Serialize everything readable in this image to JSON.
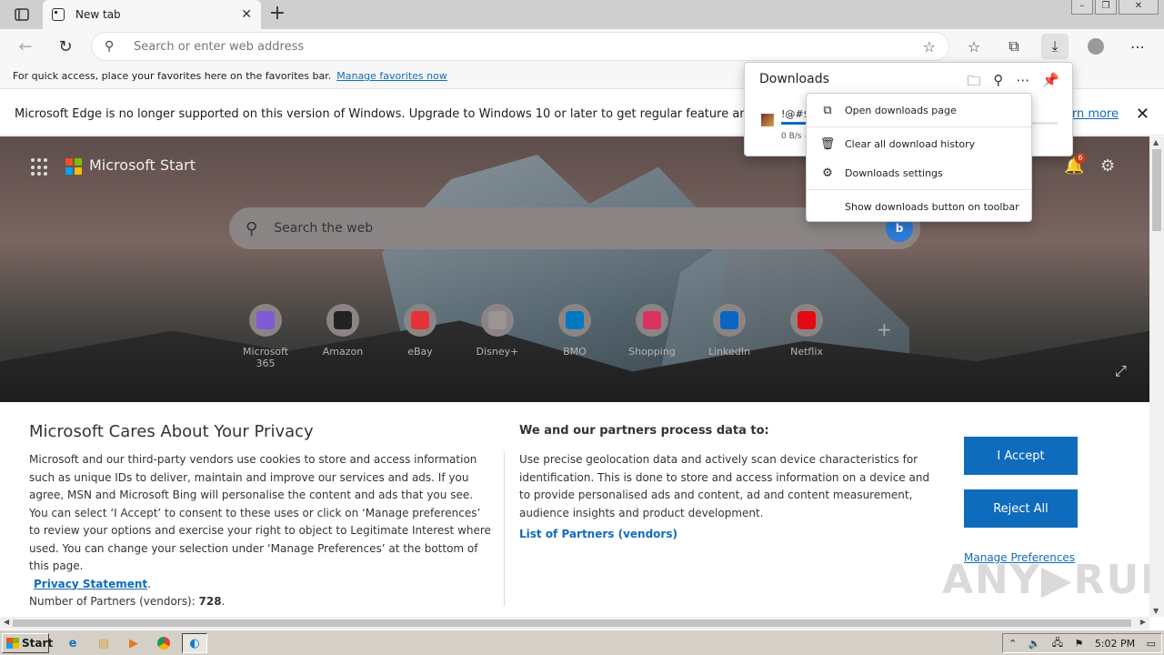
{
  "browser": {
    "tab_title": "New tab",
    "address_placeholder": "Search or enter web address",
    "favbar_text": "For quick access, place your favorites here on the favorites bar.",
    "favbar_link": "Manage favorites now",
    "infobar_text": "Microsoft Edge is no longer supported on this version of Windows. Upgrade to Windows 10 or later to get regular feature and security u",
    "infobar_link": "arn more"
  },
  "downloads": {
    "title": "Downloads",
    "item_name": "!@#$",
    "item_status": "0 B/s -",
    "progress": 0.1,
    "menu": [
      {
        "label": "Open downloads page",
        "icon": "external-link-icon"
      },
      {
        "label": "Clear all download history",
        "icon": "trash-icon"
      },
      {
        "label": "Downloads settings",
        "icon": "gear-icon"
      },
      {
        "label": "Show downloads button on toolbar",
        "icon": ""
      }
    ]
  },
  "start": {
    "brand": "Microsoft Start",
    "search_placeholder": "Search the web",
    "notification_count": "6",
    "quick_links": [
      {
        "label": "Microsoft 365",
        "color": "#7f5ad6"
      },
      {
        "label": "Amazon",
        "color": "#222222"
      },
      {
        "label": "eBay",
        "color": "#e53238"
      },
      {
        "label": "Disney+",
        "color": "#9a9593"
      },
      {
        "label": "BMO",
        "color": "#0079c1"
      },
      {
        "label": "Shopping",
        "color": "#d9325e"
      },
      {
        "label": "LinkedIn",
        "color": "#0a66c2"
      },
      {
        "label": "Netflix",
        "color": "#e50914"
      }
    ]
  },
  "privacy": {
    "title": "Microsoft Cares About Your Privacy",
    "left_text": "Microsoft and our third-party vendors use cookies to store and access information such as unique IDs to deliver, maintain and improve our services and ads. If you agree, MSN and Microsoft Bing will personalise the content and ads that you see. You can select ‘I Accept’ to consent to these uses or click on ‘Manage preferences’ to review your options and exercise your right to object to Legitimate Interest where used.  You can change your selection under ‘Manage Preferences’ at the bottom of this page.",
    "privacy_link": "Privacy Statement",
    "partners_count_label": "Number of Partners (vendors):",
    "partners_count": "728",
    "mid_title": "We and our partners process data to:",
    "mid_text": "Use precise geolocation data and actively scan device characteristics for identification. This is done to store and access information on a device and to provide personalised ads and content, ad and content measurement, audience insights and product development.",
    "partners_link": "List of Partners (vendors)",
    "accept": "I Accept",
    "reject": "Reject All",
    "manage": "Manage Preferences",
    "watermark": "ANY.RUN"
  },
  "taskbar": {
    "start": "Start",
    "time": "5:02 PM"
  }
}
